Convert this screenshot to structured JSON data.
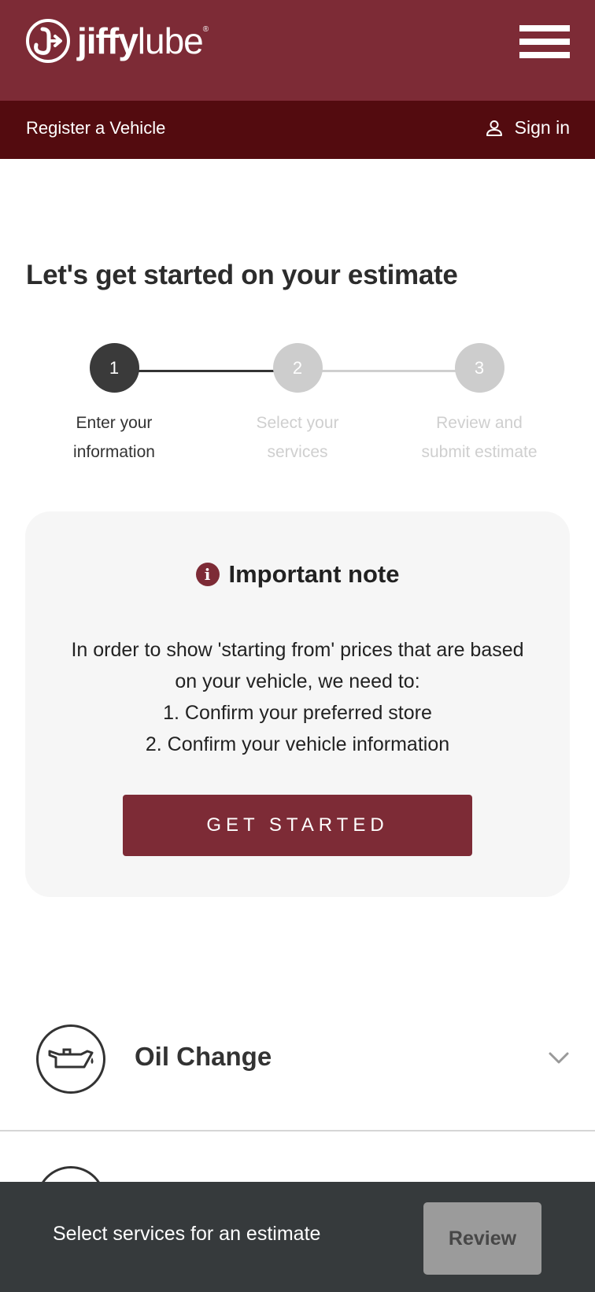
{
  "header": {
    "logo_primary": "jiffy",
    "logo_secondary": "lube",
    "logo_mark": "®",
    "menu_icon": "hamburger-menu-icon",
    "brand_color": "#7d2b36"
  },
  "subnav": {
    "register_label": "Register a Vehicle",
    "signin_label": "Sign in",
    "signin_icon": "user-icon",
    "bg_color": "#530b0f"
  },
  "page": {
    "title": "Let's get started on your estimate"
  },
  "stepper": {
    "steps": [
      {
        "number": "1",
        "line1": "Enter your",
        "line2": "information",
        "state": "active"
      },
      {
        "number": "2",
        "line1": "Select your",
        "line2": "services",
        "state": "inactive"
      },
      {
        "number": "3",
        "line1": "Review and",
        "line2": "submit estimate",
        "state": "inactive"
      }
    ]
  },
  "note": {
    "icon": "info-icon",
    "title": "Important note",
    "line1": "In order to show 'starting from' prices that are based",
    "line2": "on your vehicle, we need to:",
    "line3": "1. Confirm your preferred store",
    "line4": "2. Confirm your vehicle information",
    "button_label": "GET STARTED"
  },
  "services": [
    {
      "label": "Oil Change",
      "icon": "oil-can-icon",
      "expand_icon": "chevron-down-icon"
    }
  ],
  "bottom_bar": {
    "text": "Select services for an estimate",
    "review_label": "Review"
  }
}
